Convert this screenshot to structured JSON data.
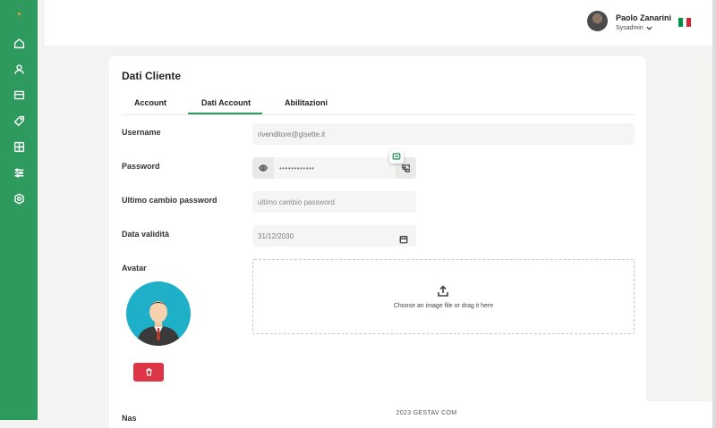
{
  "header": {
    "user_name": "Paolo Zanarini",
    "user_role": "Sysadmin",
    "flag_colors": [
      "#009246",
      "#ffffff",
      "#ce2b37"
    ]
  },
  "sidebar": {
    "icons": [
      "home-icon",
      "user-icon",
      "card-icon",
      "tag-icon",
      "grid-icon",
      "sliders-icon",
      "settings-icon"
    ]
  },
  "card": {
    "title": "Dati Cliente",
    "tabs": [
      {
        "label": "Account",
        "active": false
      },
      {
        "label": "Dati Account",
        "active": true
      },
      {
        "label": "Abilitazioni",
        "active": false
      }
    ]
  },
  "form": {
    "username_label": "Username",
    "username_value": "rivenditore@gisette.it",
    "password_label": "Password",
    "password_value": "••••••••••••",
    "last_change_label": "Ultimo cambio password",
    "last_change_placeholder": "ultimo cambio password",
    "validity_label": "Data validità",
    "validity_value": "31/12/2030",
    "avatar_label": "Avatar",
    "upload_text": "Choose an image file or drag it here",
    "partial_label": "Nas"
  },
  "footer": {
    "text": "2023 GESTAV   COM"
  },
  "colors": {
    "brand_green": "#2e9a5e",
    "danger": "#dc3545",
    "avatar_bg": "#1fb0c9"
  }
}
